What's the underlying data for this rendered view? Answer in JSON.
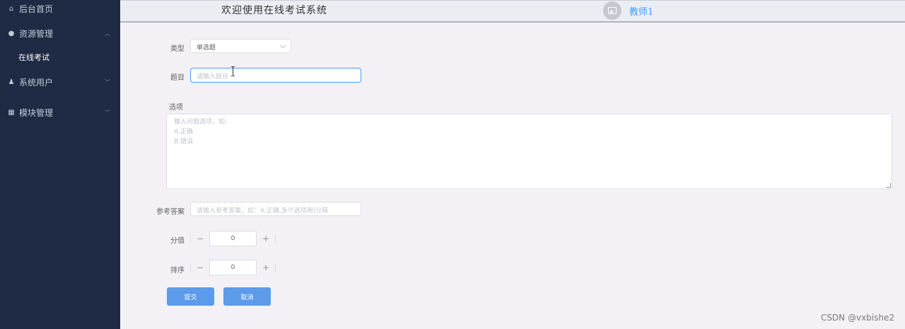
{
  "sidebar": {
    "items": [
      {
        "icon": "home-icon",
        "glyph": "⌂",
        "label": "后台首页"
      },
      {
        "icon": "location-icon",
        "glyph": "●",
        "label": "资源管理"
      },
      {
        "icon": "user-icon",
        "glyph": "♟",
        "label": "系统用户"
      },
      {
        "icon": "grid-icon",
        "glyph": "▦",
        "label": "模块管理"
      }
    ],
    "sub_items": [
      {
        "label": "在线考试"
      }
    ]
  },
  "header": {
    "title": "欢迎使用在线考试系统",
    "username": "教师1",
    "avatar_icon": "image-icon"
  },
  "form": {
    "type_label": "类型",
    "type_value": "单选题",
    "question_label": "题目",
    "question_placeholder": "请输入题目",
    "options_label": "选项",
    "options_placeholder_lines": [
      "输入问题选项，如:",
      "A.正确",
      "B.错误"
    ],
    "answer_label": "参考答案",
    "answer_placeholder": "请输入参考答案，如：A.正确,多个选项用|分隔",
    "score_label": "分值",
    "score_value": "0",
    "order_label": "排序",
    "order_value": "0",
    "minus": "−",
    "plus": "+",
    "submit_label": "提交",
    "cancel_label": "取消"
  },
  "watermark": "CSDN @vxbishe2",
  "colors": {
    "sidebar_bg": "#1f2a44",
    "primary": "#409eff",
    "button": "#5b9bea"
  }
}
